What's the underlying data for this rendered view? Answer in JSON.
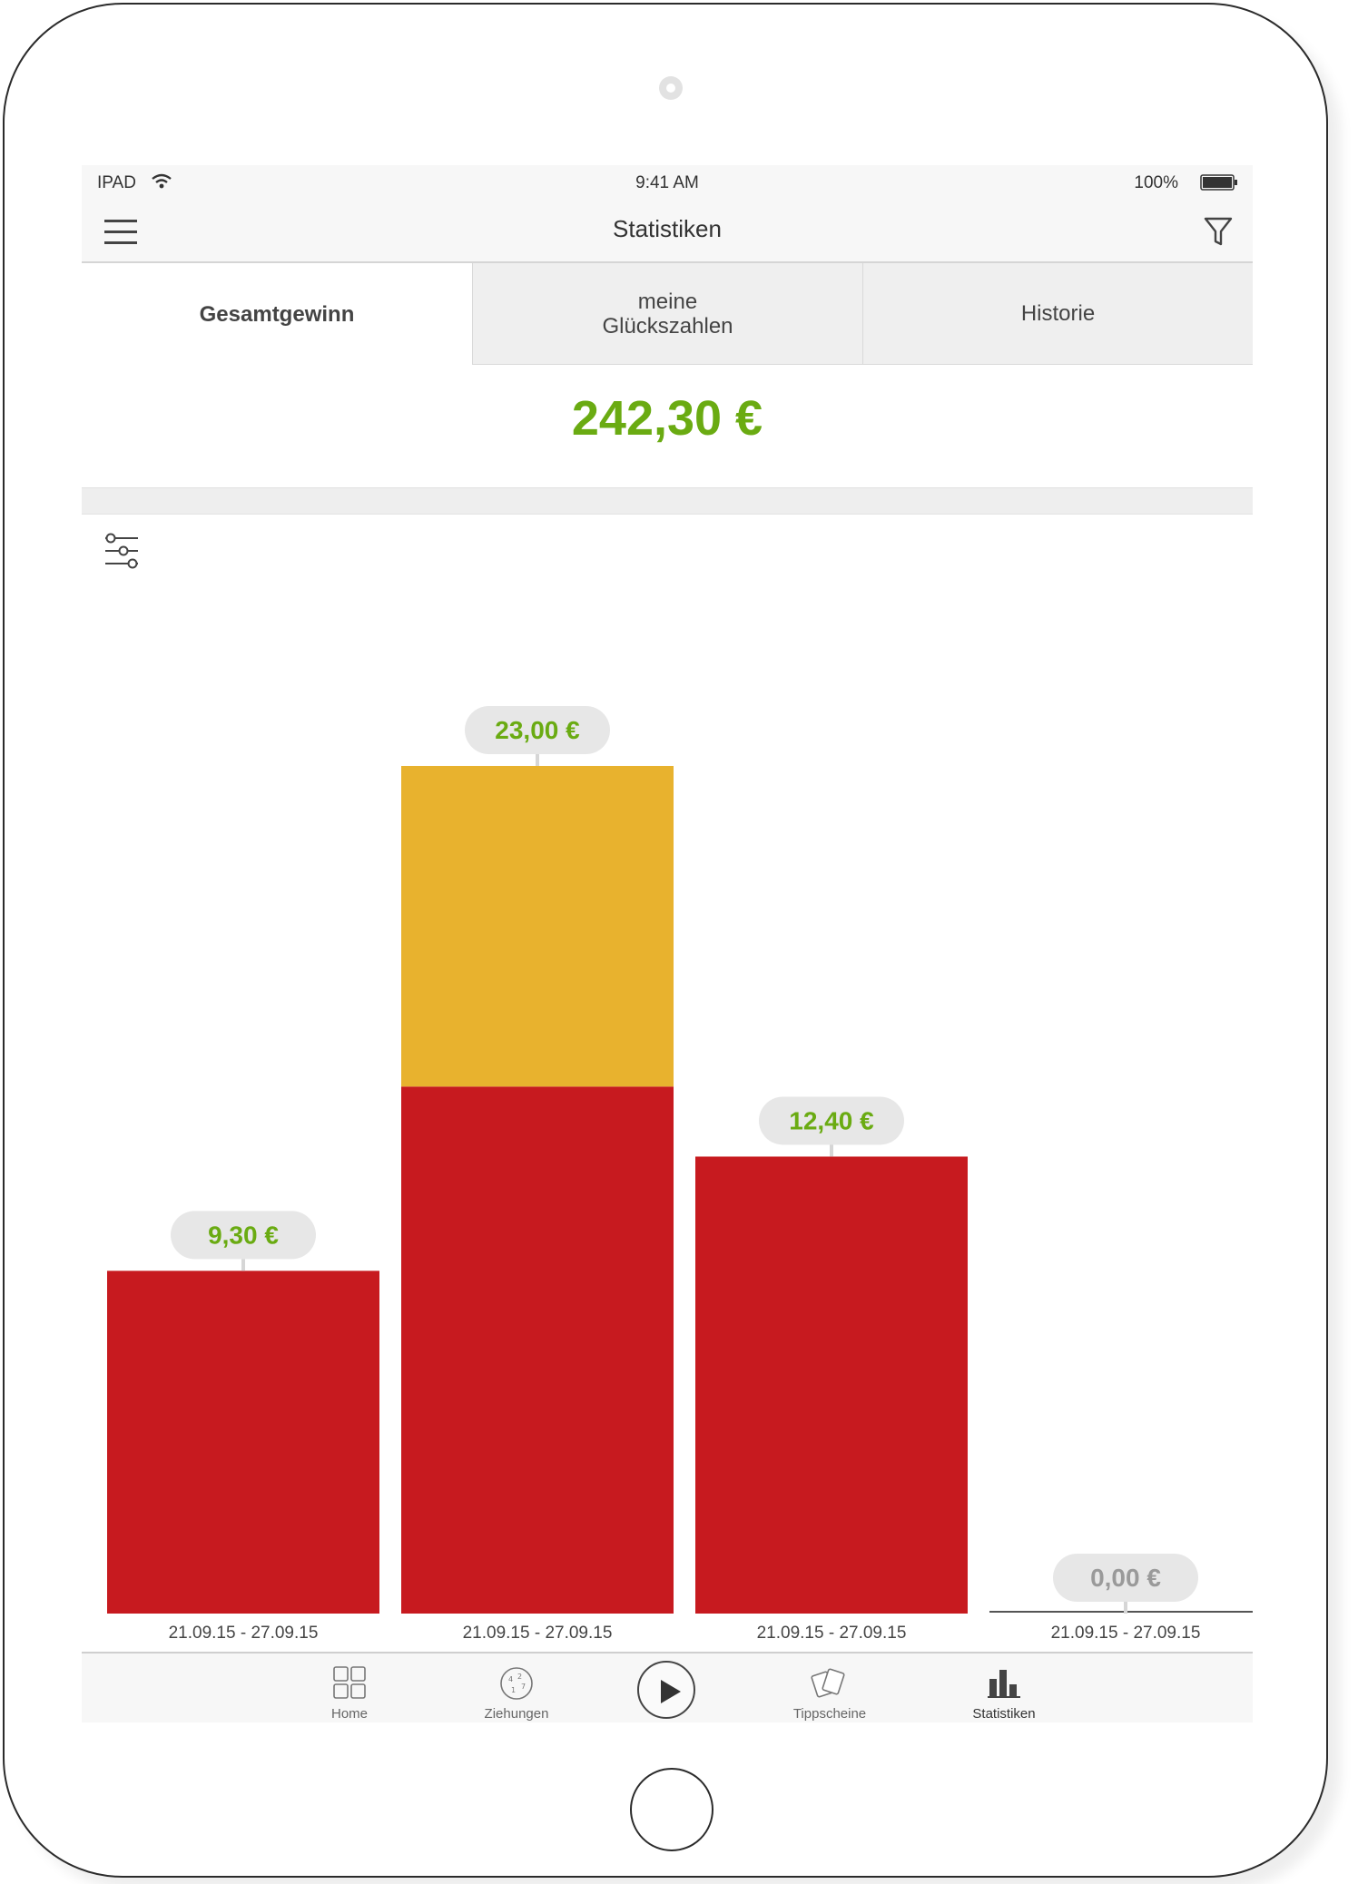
{
  "status_bar": {
    "device": "IPAD",
    "time": "9:41 AM",
    "battery": "100%"
  },
  "nav": {
    "title": "Statistiken",
    "menu_icon": "hamburger-icon",
    "filter_icon": "filter-icon"
  },
  "tabs": [
    {
      "label": "Gesamtgewinn",
      "active": true
    },
    {
      "label": "meine\nGlückszahlen",
      "active": false
    },
    {
      "label": "Historie",
      "active": false
    }
  ],
  "total": "242,30 €",
  "colors": {
    "accent": "#6aab12",
    "bar_red": "#c71a1f",
    "bar_yellow": "#e8b22e",
    "zero_label": "#9a9a9a",
    "pill_bg": "#e7e7e7"
  },
  "chart_data": {
    "type": "bar",
    "stacked": true,
    "categories": [
      "21.09.15 - 27.09.15",
      "21.09.15 - 27.09.15",
      "21.09.15 - 27.09.15",
      "21.09.15 - 27.09.15"
    ],
    "value_labels": [
      "9,30 €",
      "23,00 €",
      "12,40 €",
      "0,00 €"
    ],
    "series": [
      {
        "values": [
          9.3,
          14.3,
          12.4,
          0
        ],
        "color": "#c71a1f"
      },
      {
        "values": [
          0,
          8.7,
          0,
          0
        ],
        "color": "#e8b22e"
      }
    ],
    "totals": [
      9.3,
      23.0,
      12.4,
      0
    ],
    "ylim": [
      0,
      23.0
    ],
    "grid": false
  },
  "tabbar": {
    "items": [
      {
        "label": "Home",
        "icon": "grid-icon"
      },
      {
        "label": "Ziehungen",
        "icon": "lottery-ball-icon"
      },
      {
        "label": "",
        "icon": "play-icon"
      },
      {
        "label": "Tippscheine",
        "icon": "tickets-icon"
      },
      {
        "label": "Statistiken",
        "icon": "bar-chart-icon"
      }
    ],
    "active": "Statistiken"
  }
}
